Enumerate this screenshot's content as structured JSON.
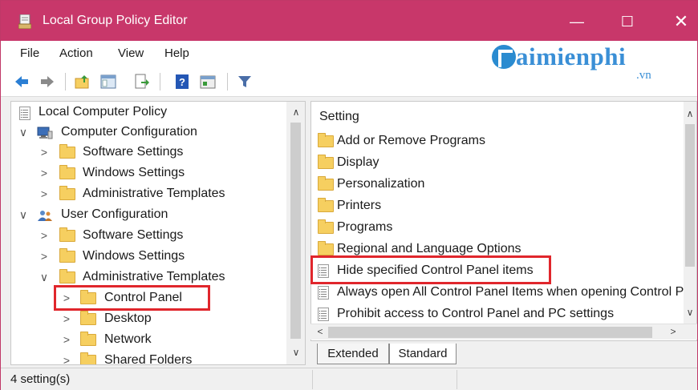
{
  "window": {
    "title": "Local Group Policy Editor",
    "min_glyph": "—",
    "max_glyph": "☐",
    "close_glyph": "✕",
    "accent_color": "#c8376a",
    "highlight_color": "#e0262c"
  },
  "menu": [
    "File",
    "Action",
    "View",
    "Help"
  ],
  "watermark": {
    "name": "aimienphi",
    "sub": ".vn"
  },
  "toolbar": {
    "icons": [
      "back-icon",
      "forward-icon",
      "up-folder-icon",
      "show-hide-tree-icon",
      "export-list-icon",
      "help-icon",
      "properties-icon",
      "filter-icon"
    ]
  },
  "tree": {
    "items": [
      {
        "label": "Local Computer Policy",
        "icon": "policy-doc-icon",
        "chevron": ""
      },
      {
        "label": "Computer Configuration",
        "icon": "computer-icon",
        "chevron": "∨"
      },
      {
        "label": "Software Settings",
        "icon": "folder-icon",
        "chevron": ">"
      },
      {
        "label": "Windows Settings",
        "icon": "folder-icon",
        "chevron": ">"
      },
      {
        "label": "Administrative Templates",
        "icon": "folder-icon",
        "chevron": ">"
      },
      {
        "label": "User Configuration",
        "icon": "users-icon",
        "chevron": "∨"
      },
      {
        "label": "Software Settings",
        "icon": "folder-icon",
        "chevron": ">"
      },
      {
        "label": "Windows Settings",
        "icon": "folder-icon",
        "chevron": ">"
      },
      {
        "label": "Administrative Templates",
        "icon": "folder-icon",
        "chevron": "∨"
      },
      {
        "label": "Control Panel",
        "icon": "folder-icon",
        "chevron": ">",
        "selected": true
      },
      {
        "label": "Desktop",
        "icon": "folder-icon",
        "chevron": ">"
      },
      {
        "label": "Network",
        "icon": "folder-icon",
        "chevron": ">"
      },
      {
        "label": "Shared Folders",
        "icon": "folder-icon",
        "chevron": ">"
      }
    ],
    "scroll_up": "∧",
    "scroll_down": "∨"
  },
  "list": {
    "header": "Setting",
    "items": [
      {
        "label": "Add or Remove Programs",
        "icon": "folder-icon"
      },
      {
        "label": "Display",
        "icon": "folder-icon"
      },
      {
        "label": "Personalization",
        "icon": "folder-icon"
      },
      {
        "label": "Printers",
        "icon": "folder-icon"
      },
      {
        "label": "Programs",
        "icon": "folder-icon"
      },
      {
        "label": "Regional and Language Options",
        "icon": "folder-icon"
      },
      {
        "label": "Hide specified Control Panel items",
        "icon": "setting-doc-icon",
        "highlighted": true
      },
      {
        "label": "Always open All Control Panel Items when opening Control Panel",
        "icon": "setting-doc-icon"
      },
      {
        "label": "Prohibit access to Control Panel and PC settings",
        "icon": "setting-doc-icon"
      }
    ],
    "scroll_up": "∧",
    "scroll_down": "∨",
    "scroll_left": "<",
    "scroll_right": ">"
  },
  "tabs": [
    "Extended",
    "Standard"
  ],
  "status": "4 setting(s)"
}
